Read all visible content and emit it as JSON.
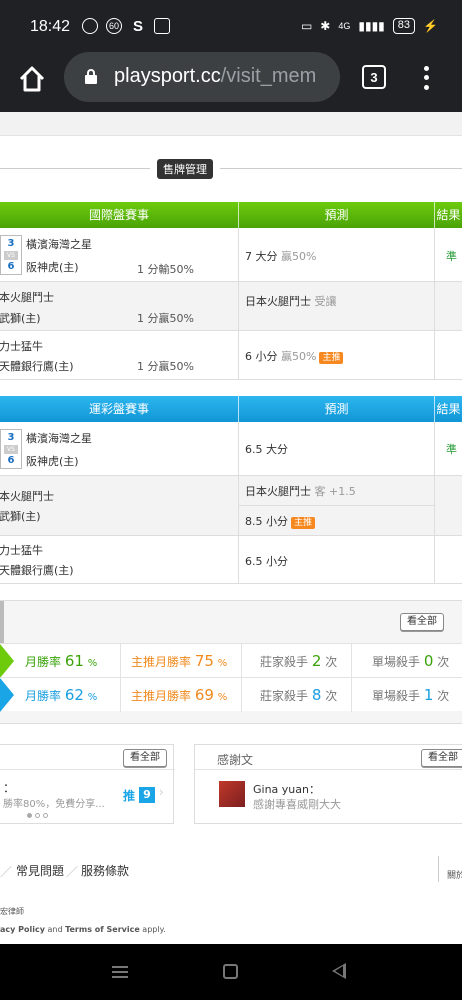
{
  "status": {
    "time": "18:42",
    "left_icons": [
      "app-icon",
      "60-icon",
      "s-icon",
      "photo-icon"
    ],
    "network": "4G",
    "battery": "83"
  },
  "browser": {
    "url_domain": "playsport.cc",
    "url_path": "/visit_mem",
    "tab_count": "3"
  },
  "page": {
    "sell_manage_label": "售牌管理",
    "table1": {
      "head_game": "國際盤賽事",
      "head_pred": "預測",
      "head_res": "結果",
      "rows": [
        {
          "score_away": "3",
          "score_home": "6",
          "vs": "VS",
          "away": "橫濱海灣之星",
          "home": "阪神虎(主)",
          "odds": "1 分輸50%",
          "pred": "7 大分",
          "pred_sub": "贏50%",
          "tag": "",
          "result": "準"
        },
        {
          "away": "日本火腿鬥士",
          "home": "西武獅(主)",
          "odds": "1 分贏50%",
          "pred": "日本火腿鬥士",
          "pred_sub": "受讓",
          "tag": "",
          "result": ""
        },
        {
          "away": "歐力士猛牛",
          "home": "樂天體銀行鷹(主)",
          "odds": "1 分贏50%",
          "pred": "6 小分",
          "pred_sub": "贏50%",
          "tag": "主推",
          "result": ""
        }
      ]
    },
    "table2": {
      "head_game": "運彩盤賽事",
      "head_pred": "預測",
      "head_res": "結果",
      "rows": [
        {
          "score_away": "3",
          "score_home": "6",
          "vs": "VS",
          "away": "橫濱海灣之星",
          "home": "阪神虎(主)",
          "pred": "6.5 大分",
          "result": "準"
        },
        {
          "away": "日本火腿鬥士",
          "home": "西武獅(主)",
          "pred": "日本火腿鬥士",
          "pred_sub": "客 +1.5",
          "pred2": "8.5 小分",
          "tag": "主推"
        },
        {
          "away": "歐力士猛牛",
          "home": "樂天體銀行鷹(主)",
          "pred": "6.5 小分"
        }
      ]
    },
    "stats": {
      "see_all": "看全部",
      "rows": [
        {
          "win_label": "月勝率",
          "win_val": "61",
          "unit": "%",
          "main_label": "主推月勝率",
          "main_val": "75",
          "killer_label": "莊家殺手",
          "killer_val": "2",
          "times": "次",
          "single_label": "單場殺手",
          "single_val": "0"
        },
        {
          "win_label": "月勝率",
          "win_val": "62",
          "unit": "%",
          "main_label": "主推月勝率",
          "main_val": "69",
          "killer_label": "莊家殺手",
          "killer_val": "8",
          "times": "次",
          "single_label": "單場殺手",
          "single_val": "1"
        }
      ]
    },
    "card_left": {
      "see_all": "看全部",
      "line1": "：",
      "line2": "勝率80%，免費分享...",
      "push_label": "推",
      "push_count": "9"
    },
    "card_right": {
      "title": "感謝文",
      "see_all": "看全部",
      "user": "Gina yuan：",
      "message": "感謝專喜威剛大大"
    },
    "footer": {
      "link1": "常見問題",
      "link2": "服務條款",
      "side": "關於",
      "lawyer": "宏律師",
      "recaptcha_a": "acy Policy",
      "recaptcha_and": " and ",
      "recaptcha_b": "Terms of Service",
      "recaptcha_c": " apply."
    }
  }
}
